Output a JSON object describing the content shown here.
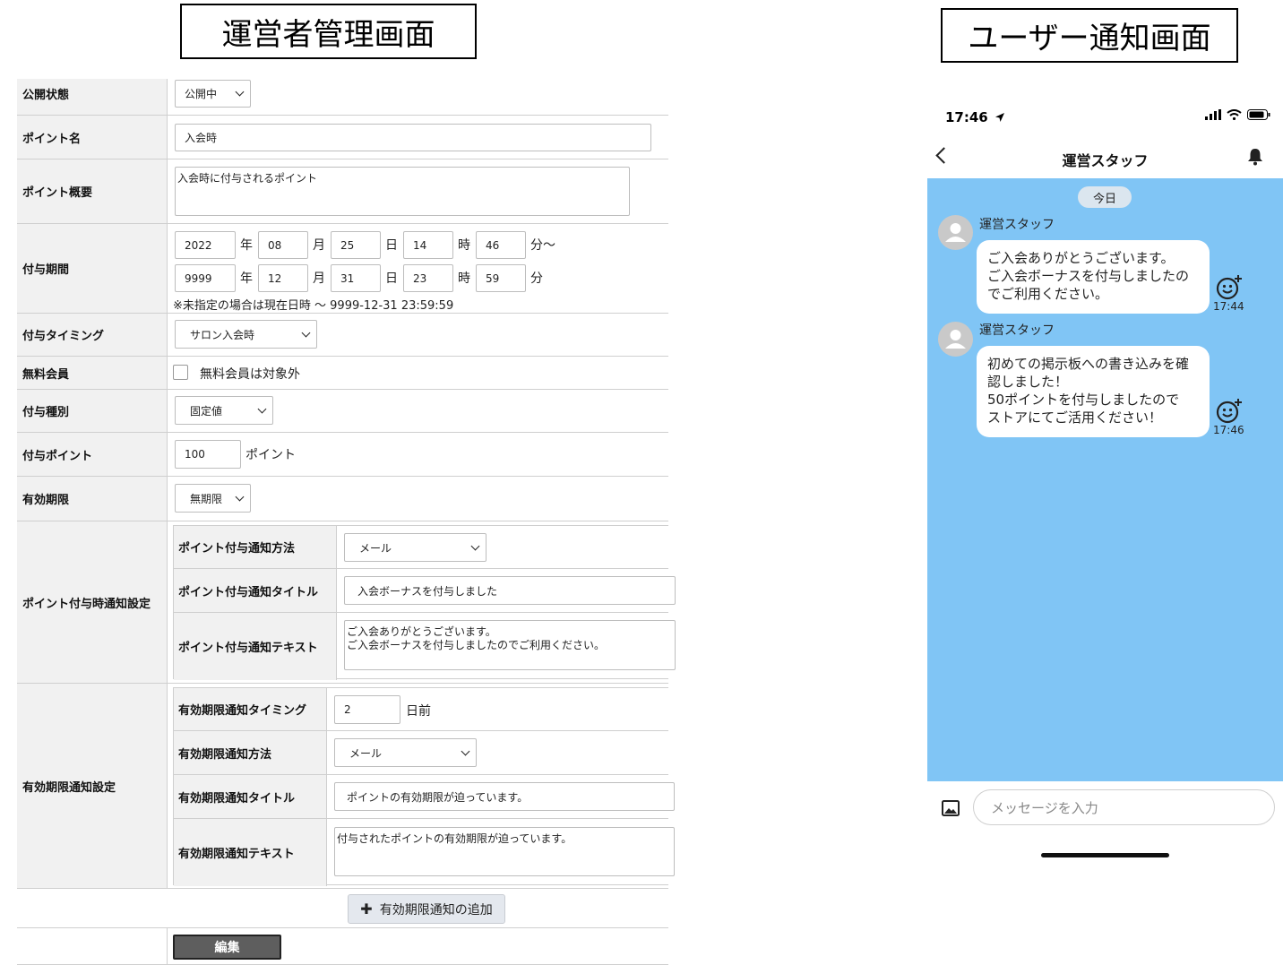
{
  "captions": {
    "admin": "運営者管理画面",
    "user": "ユーザー通知画面"
  },
  "form": {
    "publish": {
      "label": "公開状態",
      "value": "公開中"
    },
    "point_name": {
      "label": "ポイント名",
      "value": "入会時"
    },
    "point_summary": {
      "label": "ポイント概要",
      "value": "入会時に付与されるポイント"
    },
    "period": {
      "label": "付与期間",
      "start": {
        "year": "2022",
        "month": "08",
        "day": "25",
        "hour": "14",
        "minute": "46"
      },
      "end": {
        "year": "9999",
        "month": "12",
        "day": "31",
        "hour": "23",
        "minute": "59"
      },
      "units": {
        "year": "年",
        "month": "月",
        "day": "日",
        "hour": "時",
        "minute_from": "分～",
        "minute_to": "分"
      },
      "note": "※未指定の場合は現在日時 ～ 9999-12-31 23:59:59"
    },
    "timing": {
      "label": "付与タイミング",
      "value": "サロン入会時"
    },
    "free_member": {
      "label": "無料会員",
      "checkbox_label": "無料会員は対象外"
    },
    "grant_type": {
      "label": "付与種別",
      "value": "固定値"
    },
    "grant_point": {
      "label": "付与ポイント",
      "value": "100",
      "unit": "ポイント"
    },
    "expiry": {
      "label": "有効期限",
      "value": "無期限"
    },
    "grant_notice": {
      "label": "ポイント付与時通知設定",
      "method": {
        "label": "ポイント付与通知方法",
        "value": "メール"
      },
      "title": {
        "label": "ポイント付与通知タイトル",
        "value": "入会ボーナスを付与しました"
      },
      "text": {
        "label": "ポイント付与通知テキスト",
        "value": "ご入会ありがとうございます。\nご入会ボーナスを付与しましたのでご利用ください。"
      }
    },
    "expiry_notice": {
      "label": "有効期限通知設定",
      "timing": {
        "label": "有効期限通知タイミング",
        "value": "2",
        "unit": "日前"
      },
      "method": {
        "label": "有効期限通知方法",
        "value": "メール"
      },
      "title": {
        "label": "有効期限通知タイトル",
        "value": "ポイントの有効期限が迫っています。"
      },
      "text": {
        "label": "有効期限通知テキスト",
        "value": "付与されたポイントの有効期限が迫っています。"
      }
    },
    "add_button": "有効期限通知の追加",
    "edit_button": "編集"
  },
  "phone": {
    "status_time": "17:46",
    "nav_title": "運営スタッフ",
    "date_pill": "今日",
    "messages": [
      {
        "sender": "運営スタッフ",
        "text": "ご入会ありがとうございます。\nご入会ボーナスを付与しましたの\nでご利用ください。",
        "time": "17:44"
      },
      {
        "sender": "運営スタッフ",
        "text": "初めての掲示板への書き込みを確\n認しました！\n50ポイントを付与しましたので\nストアにてご活用ください！",
        "time": "17:46"
      }
    ],
    "input_placeholder": "メッセージを入力"
  }
}
